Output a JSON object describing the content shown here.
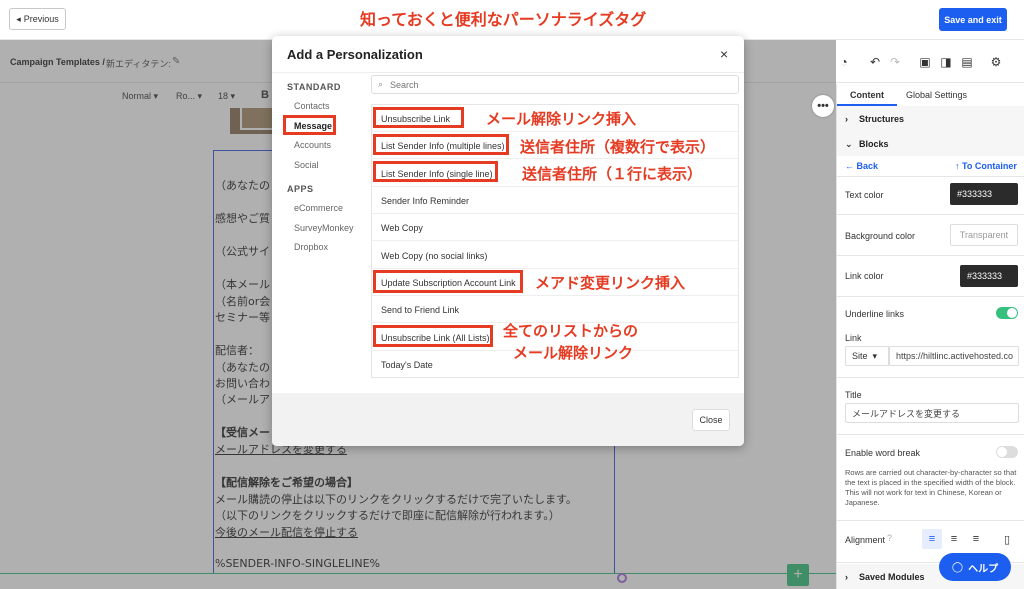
{
  "topbar": {
    "previous_label": "Previous",
    "save_exit_label": "Save and exit"
  },
  "annotation_title": "知っておくと便利なパーソナライズタグ",
  "breadcrumb": {
    "section": "Campaign Templates /",
    "name": "新エディタテン:"
  },
  "format_bar": {
    "style": "Normal",
    "font": "Ro...",
    "size": "18",
    "bold": "B"
  },
  "email_body": {
    "lines": [
      "（あなたの",
      "感想やご質",
      "（公式サイ",
      "（本メール",
      "（名前or会",
      "セミナー等",
      "配信者：",
      "（あなたの",
      "お問い合わ",
      "（メールア",
      "【受信メー",
      "メールアドレスを変更する",
      "【配信解除をご希望の場合】",
      "メール購読の停止は以下のリンクをクリックするだけで完了いたします。",
      "（以下のリンクをクリックするだけで即座に配信解除が行われます。）",
      "今後のメール配信を停止する",
      "%SENDER-INFO-SINGLELINE%"
    ]
  },
  "modal": {
    "title": "Add a Personalization",
    "close_icon": "×",
    "standard_heading": "STANDARD",
    "standard_items": [
      "Contacts",
      "Message",
      "Accounts",
      "Social"
    ],
    "apps_heading": "APPS",
    "apps_items": [
      "eCommerce",
      "SurveyMonkey",
      "Dropbox"
    ],
    "search_placeholder": "Search",
    "options": [
      "Unsubscribe Link",
      "List Sender Info (multiple lines)",
      "List Sender Info (single line)",
      "Sender Info Reminder",
      "Web Copy",
      "Web Copy (no social links)",
      "Update Subscription Account Link",
      "Send to Friend Link",
      "Unsubscribe Link (All Lists)",
      "Today's Date"
    ],
    "close_label": "Close"
  },
  "annotations": {
    "unsubscribe": "メール解除リンク挿入",
    "multi_line": "送信者住所（複数行で表示）",
    "single_line": "送信者住所（１行に表示）",
    "update_email": "メアド変更リンク挿入",
    "all_lists_1": "全てのリストからの",
    "all_lists_2": "メール解除リンク"
  },
  "panel": {
    "tab_content": "Content",
    "tab_global": "Global Settings",
    "structures": "Structures",
    "blocks": "Blocks",
    "back": "Back",
    "to_container": "To Container",
    "text_color_label": "Text color",
    "text_color_value": "#333333",
    "bg_color_label": "Background color",
    "bg_color_value": "Transparent",
    "link_color_label": "Link color",
    "link_color_value": "#333333",
    "underline_label": "Underline links",
    "link_label": "Link",
    "link_type": "Site",
    "link_url": "https://hiltlinc.activehosted.co",
    "title_label": "Title",
    "title_value": "メールアドレスを変更する",
    "word_break_label": "Enable word break",
    "word_break_note": "Rows are carried out character-by-character so that the text is placed in the specified width of the block. This will not work for text in Chinese, Korean or Japanese.",
    "alignment_label": "Alignment",
    "saved_modules": "Saved Modules"
  },
  "help_label": "ヘルプ",
  "colors": {
    "accent": "#1b5ef0",
    "annotation": "#e53b22",
    "toggle_on": "#36c080"
  }
}
